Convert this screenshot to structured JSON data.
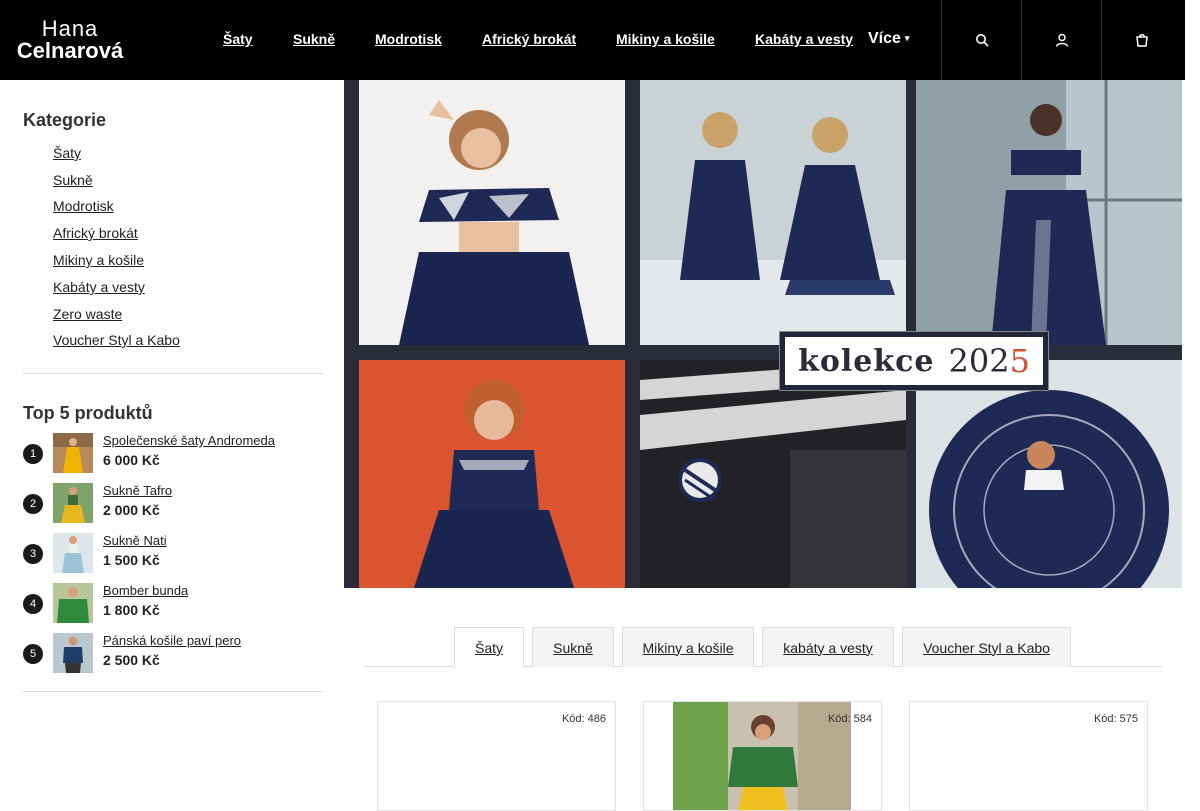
{
  "header": {
    "logo_line1": "Hana",
    "logo_line2": "Celnarová",
    "nav": [
      "Šaty",
      "Sukně",
      "Modrotisk",
      "Africký brokát",
      "Mikiny a košile",
      "Kabáty a vesty"
    ],
    "more_label": "Více"
  },
  "sidebar": {
    "categories_title": "Kategorie",
    "categories": [
      "Šaty",
      "Sukně",
      "Modrotisk",
      "Africký brokát",
      "Mikiny a košile",
      "Kabáty a vesty",
      "Zero waste",
      "Voucher Styl a Kabo"
    ],
    "top_title": "Top 5 produktů",
    "top_products": [
      {
        "rank": "1",
        "name": "Společenské šaty Andromeda",
        "price": "6 000 Kč"
      },
      {
        "rank": "2",
        "name": "Sukně Tafro",
        "price": "2 000 Kč"
      },
      {
        "rank": "3",
        "name": "Sukně Nati",
        "price": "1 500 Kč"
      },
      {
        "rank": "4",
        "name": "Bomber bunda",
        "price": "1 800 Kč"
      },
      {
        "rank": "5",
        "name": "Pánská košile paví pero",
        "price": "2 500 Kč"
      }
    ]
  },
  "banner": {
    "collection_word": "kolekce",
    "year_prefix": "202",
    "year_last": "5"
  },
  "tabs": [
    "Šaty",
    "Sukně",
    "Mikiny a košile",
    "kabáty a vesty",
    "Voucher Styl a Kabo"
  ],
  "products": [
    {
      "code": "Kód: 486"
    },
    {
      "code": "Kód: 584"
    },
    {
      "code": "Kód: 575"
    }
  ],
  "colors": {
    "header_bg": "#000000",
    "accent_orange": "#d94a2f",
    "navy": "#1f2a4d"
  }
}
